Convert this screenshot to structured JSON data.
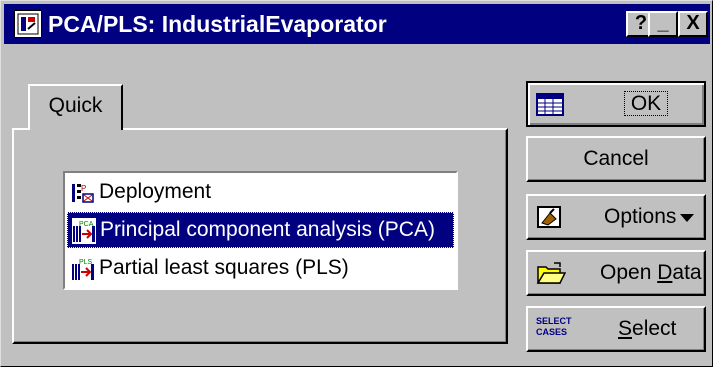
{
  "window": {
    "title": "PCA/PLS: IndustrialEvaporator"
  },
  "titlebar": {
    "help": "?",
    "minimize": "_",
    "close": "X"
  },
  "tabs": [
    {
      "label": "Quick"
    }
  ],
  "list": {
    "items": [
      {
        "label": "Deployment",
        "selected": false
      },
      {
        "label": "Principal component analysis (PCA)",
        "selected": true
      },
      {
        "label": "Partial least squares (PLS)",
        "selected": false
      }
    ]
  },
  "buttons": {
    "ok": "OK",
    "cancel": "Cancel",
    "options": "Options",
    "open_data_pre": "Open ",
    "open_data_key": "D",
    "open_data_post": "ata",
    "select_key": "S",
    "select_post": "elect",
    "select_icon_text": [
      "SELECT",
      "CASES"
    ]
  },
  "icons": {
    "app": "evaporator-app-icon",
    "ok": "spreadsheet-icon",
    "options": "hand-pointer-icon",
    "open": "folder-open-icon",
    "select": "select-cases-icon",
    "deployment": "deployment-icon",
    "pca": "pca-icon",
    "pls": "pls-icon"
  }
}
